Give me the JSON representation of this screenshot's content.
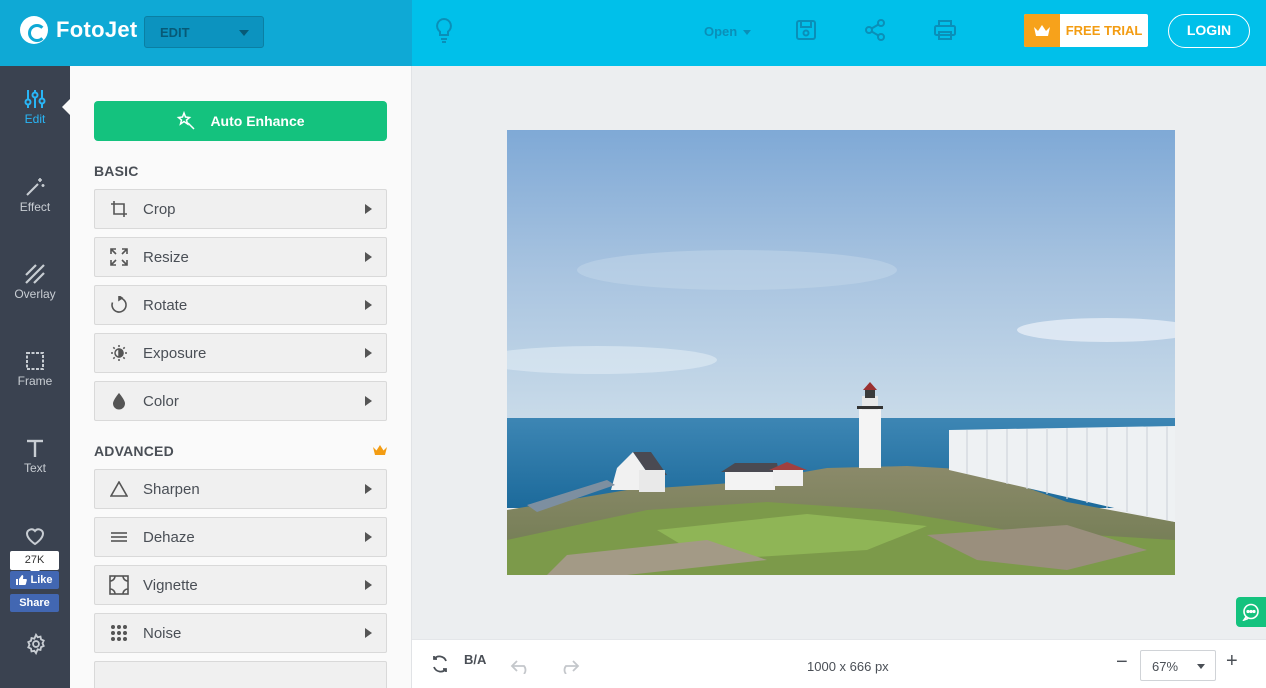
{
  "app": {
    "name": "FotoJet",
    "mode": "EDIT",
    "open_label": "Open",
    "free_trial_label": "FREE TRIAL",
    "login_label": "LOGIN",
    "accent": "#00c0ea",
    "brand_dark": "#0fa9d5",
    "trial_orange": "#f7a21b"
  },
  "rail": {
    "items": [
      {
        "label": "Edit",
        "icon": "sliders-icon"
      },
      {
        "label": "Effect",
        "icon": "magic-wand-icon"
      },
      {
        "label": "Overlay",
        "icon": "overlay-icon"
      },
      {
        "label": "Frame",
        "icon": "frame-icon"
      },
      {
        "label": "Text",
        "icon": "text-icon"
      }
    ],
    "likes_count": "27K",
    "like_label": "Like",
    "share_label": "Share"
  },
  "panel": {
    "auto_enhance_label": "Auto Enhance",
    "basic_title": "BASIC",
    "advanced_title": "ADVANCED",
    "basic_tools": [
      {
        "label": "Crop",
        "icon": "crop-icon"
      },
      {
        "label": "Resize",
        "icon": "resize-icon"
      },
      {
        "label": "Rotate",
        "icon": "rotate-icon"
      },
      {
        "label": "Exposure",
        "icon": "exposure-icon"
      },
      {
        "label": "Color",
        "icon": "droplet-icon"
      }
    ],
    "advanced_tools": [
      {
        "label": "Sharpen",
        "icon": "triangle-icon"
      },
      {
        "label": "Dehaze",
        "icon": "lines-icon"
      },
      {
        "label": "Vignette",
        "icon": "vignette-icon"
      },
      {
        "label": "Noise",
        "icon": "dots-grid-icon"
      }
    ],
    "green": "#14c27e"
  },
  "bottom": {
    "before_after_label": "B/A",
    "dimensions": "1000 x 666 px",
    "zoom": "67%"
  }
}
